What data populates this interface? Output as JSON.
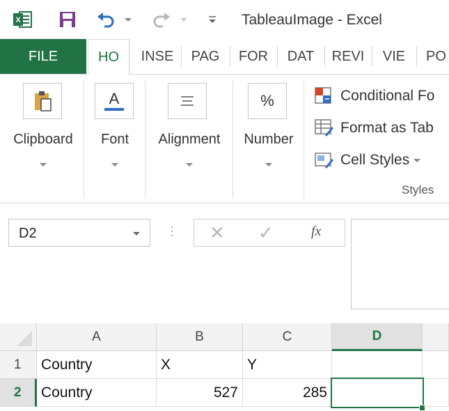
{
  "title_bar": {
    "window_title": "TableauImage - Excel",
    "icons": [
      "excel-logo",
      "save-icon",
      "undo-icon",
      "redo-icon",
      "customize-qat-icon"
    ]
  },
  "ribbon_tabs": [
    {
      "label": "FILE"
    },
    {
      "label": "HO"
    },
    {
      "label": "INSE"
    },
    {
      "label": "PAG"
    },
    {
      "label": "FOR"
    },
    {
      "label": "DAT"
    },
    {
      "label": "REVI"
    },
    {
      "label": "VIE"
    },
    {
      "label": "PO"
    }
  ],
  "ribbon": {
    "clipboard_label": "Clipboard",
    "font_label": "Font",
    "alignment_label": "Alignment",
    "number_label": "Number",
    "number_icon_text": "%",
    "font_icon_text": "A",
    "styles": {
      "conditional_formatting": "Conditional Fo",
      "format_as_table": "Format as Tab",
      "cell_styles": "Cell Styles",
      "group_label": "Styles"
    }
  },
  "formula_bar": {
    "name_box_value": "D2",
    "cancel_symbol": "✕",
    "enter_symbol": "✓",
    "fx_symbol": "fx",
    "formula_value": ""
  },
  "sheet": {
    "columns": [
      "A",
      "B",
      "C",
      "D"
    ],
    "active_column": "D",
    "rows": [
      {
        "header": "1",
        "cells": [
          "Country",
          "X",
          "Y",
          ""
        ]
      },
      {
        "header": "2",
        "cells": [
          "Country",
          "527",
          "285",
          ""
        ]
      }
    ],
    "active_row": "2",
    "selected_cell": "D2"
  },
  "colors": {
    "accent": "#217346",
    "qat_save": "#7e3b8c",
    "qat_undo": "#2e6ebf"
  }
}
